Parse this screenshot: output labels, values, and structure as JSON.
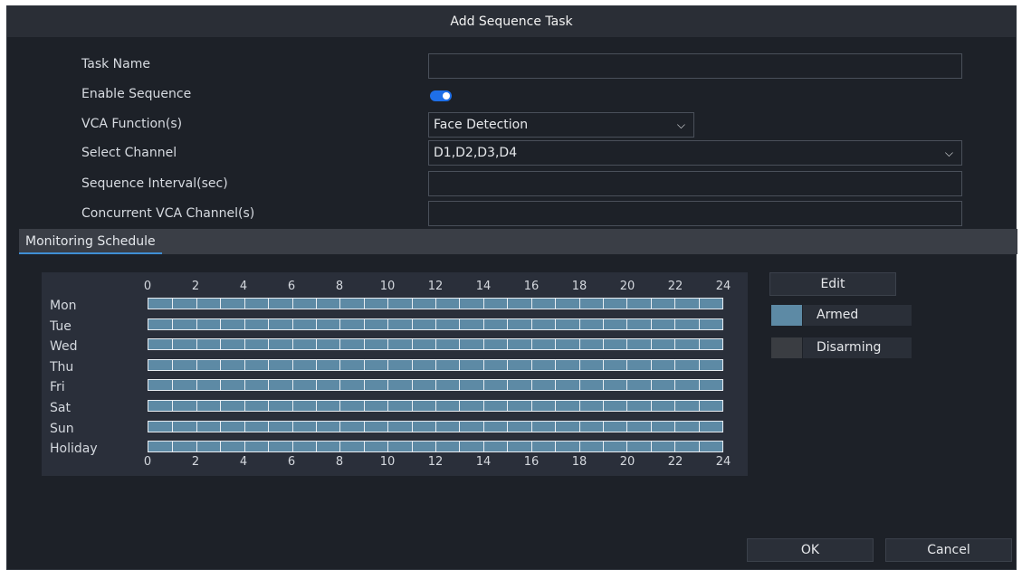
{
  "dialog": {
    "title": "Add Sequence Task"
  },
  "form": {
    "task_name_label": "Task Name",
    "task_name_value": "",
    "enable_sequence_label": "Enable Sequence",
    "enable_sequence_on": true,
    "vca_function_label": "VCA Function(s)",
    "vca_function_value": "Face Detection",
    "select_channel_label": "Select Channel",
    "select_channel_value": "D1,D2,D3,D4",
    "sequence_interval_label": "Sequence Interval(sec)",
    "sequence_interval_value": "",
    "concurrent_channels_label": "Concurrent VCA Channel(s)",
    "concurrent_channels_value": ""
  },
  "schedule": {
    "tab_label": "Monitoring Schedule",
    "hours": [
      "0",
      "2",
      "4",
      "6",
      "8",
      "10",
      "12",
      "14",
      "16",
      "18",
      "20",
      "22",
      "24"
    ],
    "days": [
      "Mon",
      "Tue",
      "Wed",
      "Thu",
      "Fri",
      "Sat",
      "Sun",
      "Holiday"
    ],
    "armed_hours_per_day": 24,
    "armed_color": "#5d8aa5",
    "disarmed_color": "#3a3d42",
    "edit_label": "Edit",
    "legend": {
      "armed_label": "Armed",
      "disarming_label": "Disarming"
    }
  },
  "footer": {
    "ok_label": "OK",
    "cancel_label": "Cancel"
  }
}
